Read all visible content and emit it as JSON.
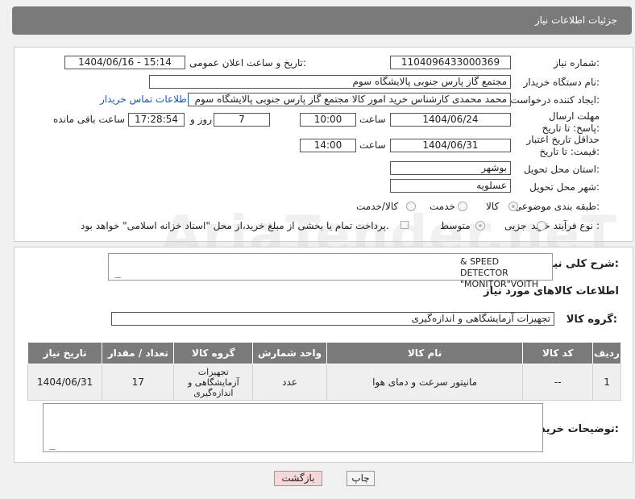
{
  "header": {
    "title": "جزئیات اطلاعات نیاز"
  },
  "form": {
    "need_number_label": "شماره نیاز:",
    "need_number": "1104096433000369",
    "announce_label": "تاریخ و ساعت اعلان عمومی:",
    "announce_value": "1404/06/16 - 15:14",
    "buyer_org_label": "نام دستگاه خریدار:",
    "buyer_org": "مجتمع گاز پارس جنوبی  پالایشگاه سوم",
    "requester_label": "ایجاد کننده درخواست:",
    "requester": "محمد محمدی کارشناس خرید امور کالا مجتمع گاز پارس جنوبی  پالایشگاه سوم",
    "contact_link": "اطلاعات تماس خریدار",
    "deadline_label": "مهلت ارسال پاسخ: تا تاریخ:",
    "deadline_date": "1404/06/24",
    "time_word": "ساعت",
    "deadline_time": "10:00",
    "days_value": "7",
    "days_word": "روز و",
    "remaining_time": "17:28:54",
    "remaining_word": "ساعت باقی مانده",
    "price_validity_label": "حداقل تاریخ اعتبار قیمت: تا تاریخ:",
    "price_validity_date": "1404/06/31",
    "price_validity_time": "14:00",
    "province_label": "استان محل تحویل:",
    "province": "بوشهر",
    "city_label": "شهر محل تحویل:",
    "city": "عسلویه",
    "category_label": "طبقه بندی موضوعی:",
    "category_options": [
      "کالا",
      "خدمت",
      "کالا/خدمت"
    ],
    "process_label": "نوع فرآیند خرید :",
    "process_options": [
      "جزیی",
      "متوسط"
    ],
    "payment_note": "پرداخت تمام یا بخشی از مبلغ خرید،از محل \"اسناد خزانه اسلامی\" خواهد بود."
  },
  "need": {
    "summary_label": "شرح کلی نیاز:",
    "summary_text": "& SPEED DETECTOR \"MONITOR\"VOITH",
    "goods_info_title": "اطلاعات کالاهای مورد نیاز",
    "goods_group_label": "گروه کالا:",
    "goods_group": "تجهیزات آزمایشگاهی و اندازه‌گیری"
  },
  "table": {
    "headers": [
      "ردیف",
      "کد کالا",
      "نام کالا",
      "واحد شمارش",
      "گروه کالا",
      "تعداد / مقدار",
      "تاریخ نیاز"
    ],
    "rows": [
      {
        "row": "1",
        "code": "--",
        "name": "مانیتور سرعت و دمای هوا",
        "unit": "عدد",
        "group": "تجهیزات آزمایشگاهی و اندازه‌گیری",
        "qty": "17",
        "date": "1404/06/31"
      }
    ]
  },
  "buyer_notes_label": "توضیحات خریدار:",
  "buttons": {
    "print": "چاپ",
    "back": "بازگشت"
  },
  "watermark": "AriaTender.neT"
}
